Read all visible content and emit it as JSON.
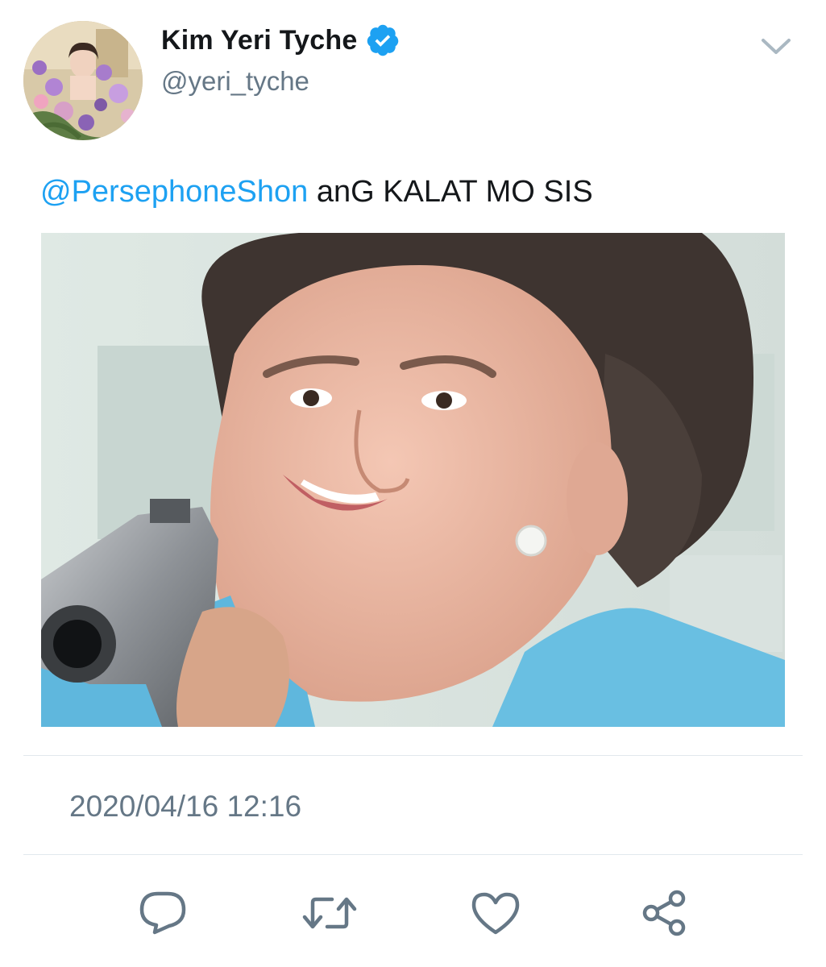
{
  "author": {
    "display_name": "Kim Yeri Tyche",
    "handle": "@yeri_tyche",
    "verified_icon": "verified-badge-icon",
    "avatar": "profile-avatar"
  },
  "menu_icon": "chevron-down-icon",
  "tweet": {
    "mention": "@PersephoneShon",
    "text": " anG KALAT MO SIS"
  },
  "media": {
    "description_icon": "attached-photo"
  },
  "timestamp": "2020/04/16 12:16",
  "actions": [
    {
      "name": "reply",
      "icon": "reply-icon"
    },
    {
      "name": "retweet",
      "icon": "retweet-icon"
    },
    {
      "name": "like",
      "icon": "heart-icon"
    },
    {
      "name": "share",
      "icon": "share-icon"
    }
  ],
  "colors": {
    "accent": "#1da1f2",
    "text": "#14171a",
    "secondary": "#657786",
    "divider": "#e1e8ed"
  }
}
